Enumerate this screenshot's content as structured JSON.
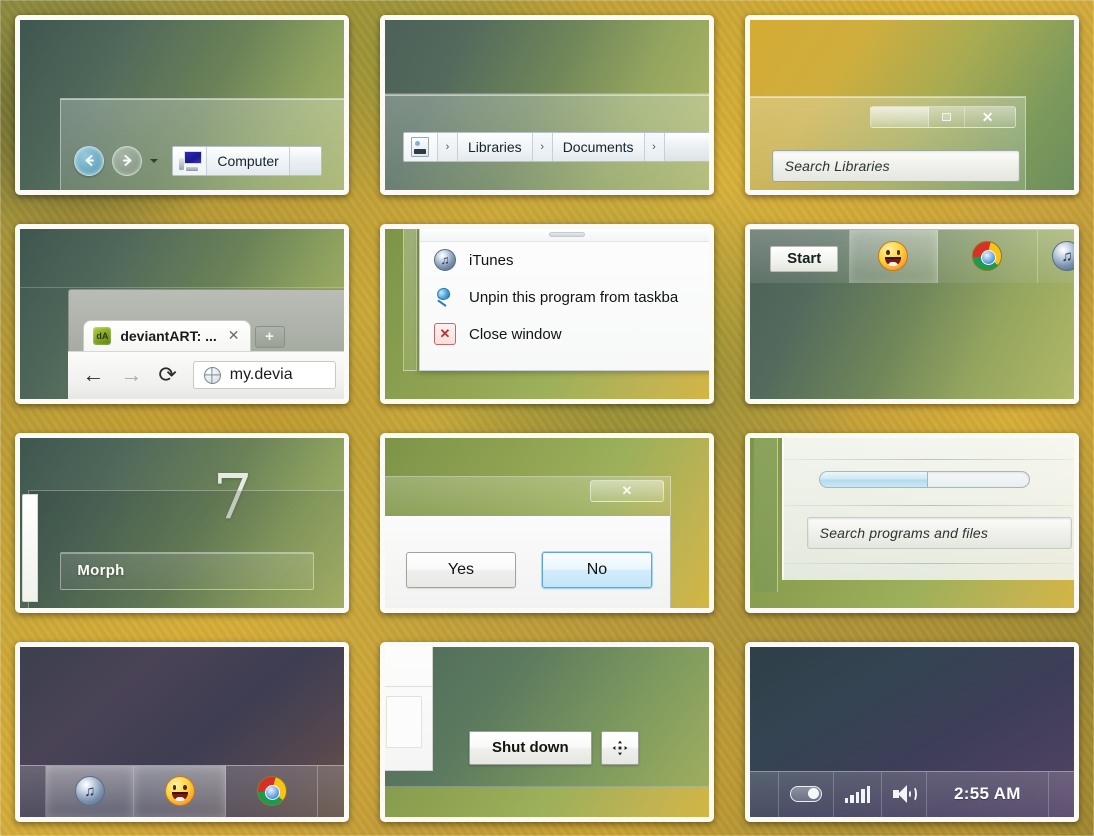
{
  "theme": {
    "name": "Morph",
    "accent_blue": "#4e96b9",
    "tile_border": "#fbfaf4"
  },
  "tiles": [
    {
      "id": "explorer-nav",
      "name": "explorer-navigation-bar",
      "back_label": "Back",
      "forward_label": "Forward",
      "history_dropdown_label": "Recent pages",
      "crumb_icon": "computer-icon",
      "crumbs": [
        "Computer"
      ]
    },
    {
      "id": "explorer-breadcrumb",
      "name": "explorer-breadcrumb-bar",
      "crumb_icon": "library-icon",
      "crumbs": [
        "Libraries",
        "Documents"
      ],
      "separator": "›"
    },
    {
      "id": "explorer-search",
      "name": "explorer-search-and-caption",
      "window_controls": {
        "minimize": "—",
        "maximize": "□",
        "close": "✕"
      },
      "search_placeholder": "Search Libraries"
    },
    {
      "id": "chrome",
      "name": "chrome-browser-window",
      "tab_title": "deviantART: ...",
      "tab_favicon": "deviantart-icon",
      "tab_close": "✕",
      "new_tab": "+",
      "back": "←",
      "forward": "→",
      "reload": "⟳",
      "address_value": "my.devia",
      "address_icon": "globe-icon"
    },
    {
      "id": "jumplist",
      "name": "taskbar-jump-list",
      "items": [
        {
          "icon": "itunes-icon",
          "label": "iTunes"
        },
        {
          "icon": "pin-icon",
          "label": "Unpin this program from taskba"
        },
        {
          "icon": "close-window-icon",
          "label": "Close window"
        }
      ]
    },
    {
      "id": "taskbar-start",
      "name": "taskbar-with-start-button",
      "start_label": "Start",
      "buttons": [
        "smiley-icon",
        "chrome-icon",
        "itunes-icon"
      ]
    },
    {
      "id": "morph",
      "name": "theme-watermark-tile",
      "watermark": "7",
      "label": "Morph"
    },
    {
      "id": "dialog",
      "name": "confirmation-dialog",
      "close_label": "✕",
      "buttons": [
        {
          "label": "Yes",
          "focused": false
        },
        {
          "label": "No",
          "focused": true
        }
      ]
    },
    {
      "id": "startmenu",
      "name": "start-menu-search",
      "progress_percent": 52,
      "search_placeholder": "Search programs and files"
    },
    {
      "id": "taskbar-dark",
      "name": "taskbar-dark-theme",
      "buttons": [
        "itunes-icon",
        "smiley-icon",
        "chrome-icon"
      ]
    },
    {
      "id": "shutdown",
      "name": "start-menu-shutdown",
      "shutdown_label": "Shut down",
      "options_icon": "four-arrow-icon"
    },
    {
      "id": "tray",
      "name": "system-tray",
      "toggle_icon": "toggle-switch-icon",
      "network_icon": "signal-bars-icon",
      "volume_icon": "speaker-icon",
      "clock": "2:55 AM"
    }
  ]
}
